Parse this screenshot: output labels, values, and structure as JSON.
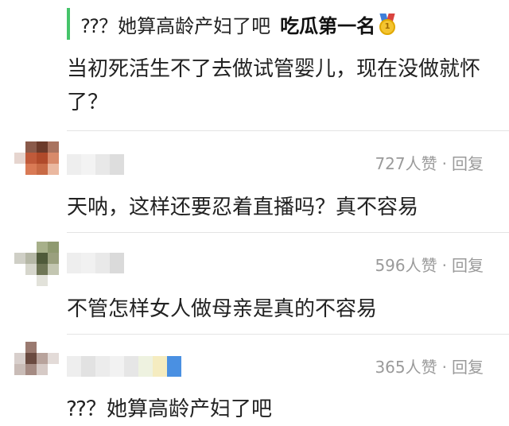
{
  "quote": {
    "text": "⁇？她算高龄产妇了吧",
    "user": "吃瓜第一名",
    "badge_icon": "gold-medal-icon"
  },
  "main_comment": {
    "text": "当初死活生不了去做试管婴儿，现在没做就怀了？"
  },
  "comments": [
    {
      "likes": "727人赞",
      "separator": "·",
      "reply_label": "回复",
      "text": "天呐，这样还要忍着直播吗？真不容易"
    },
    {
      "likes": "596人赞",
      "separator": "·",
      "reply_label": "回复",
      "text": "不管怎样女人做母亲是真的不容易"
    },
    {
      "likes": "365人赞",
      "separator": "·",
      "reply_label": "回复",
      "text": "⁇？她算高龄产妇了吧"
    }
  ],
  "colors": {
    "quote_bar": "#45c46a",
    "meta_text": "#9a9a9a",
    "body_text": "#222222"
  }
}
